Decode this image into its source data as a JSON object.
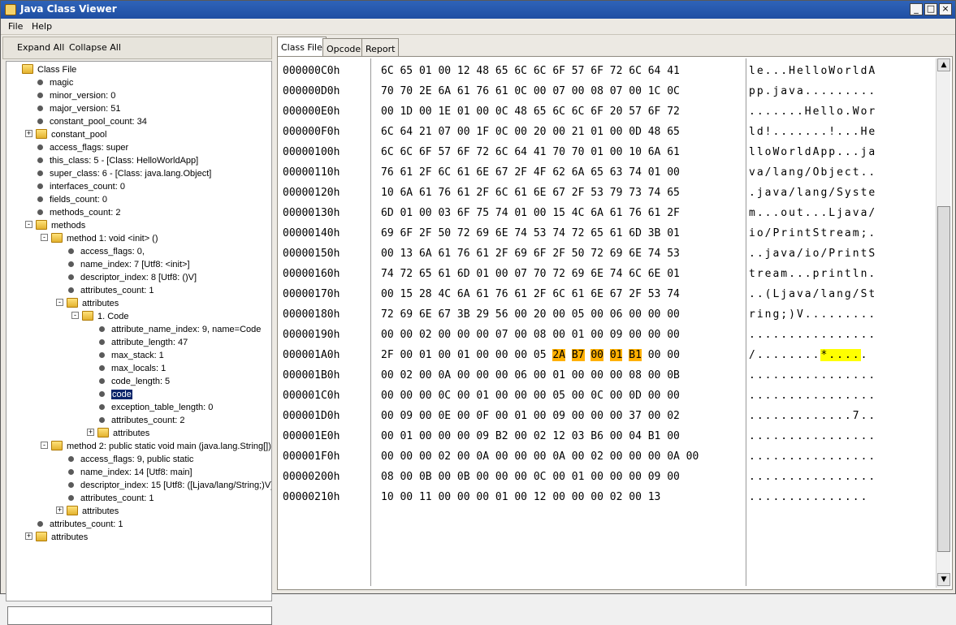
{
  "window": {
    "title": "Java Class Viewer",
    "minimize": "_",
    "maximize": "□",
    "close": "×"
  },
  "menu": [
    "File",
    "Help"
  ],
  "toolbar": {
    "expand_all": "Expand All",
    "collapse_all": "Collapse All"
  },
  "tree": [
    {
      "indent": 0,
      "kind": "folder",
      "toggle": "",
      "label": "Class File"
    },
    {
      "indent": 1,
      "kind": "leaf",
      "toggle": "",
      "label": "magic"
    },
    {
      "indent": 1,
      "kind": "leaf",
      "toggle": "",
      "label": "minor_version: 0"
    },
    {
      "indent": 1,
      "kind": "leaf",
      "toggle": "",
      "label": "major_version: 51"
    },
    {
      "indent": 1,
      "kind": "leaf",
      "toggle": "",
      "label": "constant_pool_count: 34"
    },
    {
      "indent": 1,
      "kind": "folder",
      "toggle": "+",
      "label": "constant_pool"
    },
    {
      "indent": 1,
      "kind": "leaf",
      "toggle": "",
      "label": "access_flags: super"
    },
    {
      "indent": 1,
      "kind": "leaf",
      "toggle": "",
      "label": "this_class: 5 - [Class: HelloWorldApp]"
    },
    {
      "indent": 1,
      "kind": "leaf",
      "toggle": "",
      "label": "super_class: 6 - [Class: java.lang.Object]"
    },
    {
      "indent": 1,
      "kind": "leaf",
      "toggle": "",
      "label": "interfaces_count: 0"
    },
    {
      "indent": 1,
      "kind": "leaf",
      "toggle": "",
      "label": "fields_count: 0"
    },
    {
      "indent": 1,
      "kind": "leaf",
      "toggle": "",
      "label": "methods_count: 2"
    },
    {
      "indent": 1,
      "kind": "folder",
      "toggle": "-",
      "label": "methods"
    },
    {
      "indent": 2,
      "kind": "folder",
      "toggle": "-",
      "label": "method 1:  void <init> ()"
    },
    {
      "indent": 3,
      "kind": "leaf",
      "toggle": "",
      "label": "access_flags: 0,"
    },
    {
      "indent": 3,
      "kind": "leaf",
      "toggle": "",
      "label": "name_index: 7 [Utf8: <init>]"
    },
    {
      "indent": 3,
      "kind": "leaf",
      "toggle": "",
      "label": "descriptor_index: 8 [Utf8: ()V]"
    },
    {
      "indent": 3,
      "kind": "leaf",
      "toggle": "",
      "label": "attributes_count: 1"
    },
    {
      "indent": 3,
      "kind": "folder",
      "toggle": "-",
      "label": "attributes"
    },
    {
      "indent": 4,
      "kind": "folder",
      "toggle": "-",
      "label": "1. Code"
    },
    {
      "indent": 5,
      "kind": "leaf",
      "toggle": "",
      "label": "attribute_name_index: 9, name=Code"
    },
    {
      "indent": 5,
      "kind": "leaf",
      "toggle": "",
      "label": "attribute_length: 47"
    },
    {
      "indent": 5,
      "kind": "leaf",
      "toggle": "",
      "label": "max_stack: 1"
    },
    {
      "indent": 5,
      "kind": "leaf",
      "toggle": "",
      "label": "max_locals: 1"
    },
    {
      "indent": 5,
      "kind": "leaf",
      "toggle": "",
      "label": "code_length: 5"
    },
    {
      "indent": 5,
      "kind": "leaf",
      "toggle": "",
      "label": "code",
      "selected": true
    },
    {
      "indent": 5,
      "kind": "leaf",
      "toggle": "",
      "label": "exception_table_length: 0"
    },
    {
      "indent": 5,
      "kind": "leaf",
      "toggle": "",
      "label": "attributes_count: 2"
    },
    {
      "indent": 5,
      "kind": "folder",
      "toggle": "+",
      "label": "attributes"
    },
    {
      "indent": 2,
      "kind": "folder",
      "toggle": "-",
      "label": "method 2: public static void main (java.lang.String[])"
    },
    {
      "indent": 3,
      "kind": "leaf",
      "toggle": "",
      "label": "access_flags: 9, public static"
    },
    {
      "indent": 3,
      "kind": "leaf",
      "toggle": "",
      "label": "name_index: 14 [Utf8: main]"
    },
    {
      "indent": 3,
      "kind": "leaf",
      "toggle": "",
      "label": "descriptor_index: 15 [Utf8: ([Ljava/lang/String;)V]"
    },
    {
      "indent": 3,
      "kind": "leaf",
      "toggle": "",
      "label": "attributes_count: 1"
    },
    {
      "indent": 3,
      "kind": "folder",
      "toggle": "+",
      "label": "attributes"
    },
    {
      "indent": 1,
      "kind": "leaf",
      "toggle": "",
      "label": "attributes_count: 1"
    },
    {
      "indent": 1,
      "kind": "folder",
      "toggle": "+",
      "label": "attributes"
    }
  ],
  "tabs": [
    "Class File",
    "Opcode",
    "Report"
  ],
  "hex_rows": [
    {
      "addr": "000000C0h",
      "hex": "6C 65 01 00 12 48 65 6C 6C 6F 57 6F 72 6C 64 41",
      "ascii": "le...HelloWorldA"
    },
    {
      "addr": "000000D0h",
      "hex": "70 70 2E 6A 61 76 61 0C 00 07 00 08 07 00 1C 0C",
      "ascii": "pp.java........."
    },
    {
      "addr": "000000E0h",
      "hex": "00 1D 00 1E 01 00 0C 48 65 6C 6C 6F 20 57 6F 72",
      "ascii": ".......Hello.Wor"
    },
    {
      "addr": "000000F0h",
      "hex": "6C 64 21 07 00 1F 0C 00 20 00 21 01 00 0D 48 65",
      "ascii": "ld!.......!...He"
    },
    {
      "addr": "00000100h",
      "hex": "6C 6C 6F 57 6F 72 6C 64 41 70 70 01 00 10 6A 61",
      "ascii": "lloWorldApp...ja"
    },
    {
      "addr": "00000110h",
      "hex": "76 61 2F 6C 61 6E 67 2F 4F 62 6A 65 63 74 01 00",
      "ascii": "va/lang/Object.."
    },
    {
      "addr": "00000120h",
      "hex": "10 6A 61 76 61 2F 6C 61 6E 67 2F 53 79 73 74 65",
      "ascii": ".java/lang/Syste"
    },
    {
      "addr": "00000130h",
      "hex": "6D 01 00 03 6F 75 74 01 00 15 4C 6A 61 76 61 2F",
      "ascii": "m...out...Ljava/"
    },
    {
      "addr": "00000140h",
      "hex": "69 6F 2F 50 72 69 6E 74 53 74 72 65 61 6D 3B 01",
      "ascii": "io/PrintStream;."
    },
    {
      "addr": "00000150h",
      "hex": "00 13 6A 61 76 61 2F 69 6F 2F 50 72 69 6E 74 53",
      "ascii": "..java/io/PrintS"
    },
    {
      "addr": "00000160h",
      "hex": "74 72 65 61 6D 01 00 07 70 72 69 6E 74 6C 6E 01",
      "ascii": "tream...println."
    },
    {
      "addr": "00000170h",
      "hex": "00 15 28 4C 6A 61 76 61 2F 6C 61 6E 67 2F 53 74",
      "ascii": "..(Ljava/lang/St"
    },
    {
      "addr": "00000180h",
      "hex": "72 69 6E 67 3B 29 56 00 20 00 05 00 06 00 00 00",
      "ascii": "ring;)V........."
    },
    {
      "addr": "00000190h",
      "hex": "00 00 02 00 00 00 07 00 08 00 01 00 09 00 00 00",
      "ascii": "................"
    },
    {
      "addr": "000001A0h",
      "hex": "2F 00 01 00 01 00 00 00 05 2A B7 00 01 B1 00 00",
      "ascii": "/........*.....",
      "hl_start": 9,
      "hl_len": 5
    },
    {
      "addr": "000001B0h",
      "hex": "00 02 00 0A 00 00 00 06 00 01 00 00 00 08 00 0B",
      "ascii": "................"
    },
    {
      "addr": "000001C0h",
      "hex": "00 00 00 0C 00 01 00 00 00 05 00 0C 00 0D 00 00",
      "ascii": "................"
    },
    {
      "addr": "000001D0h",
      "hex": "00 09 00 0E 00 0F 00 01 00 09 00 00 00 37 00 02",
      "ascii": ".............7.."
    },
    {
      "addr": "000001E0h",
      "hex": "00 01 00 00 00 09 B2 00 02 12 03 B6 00 04 B1 00",
      "ascii": "................"
    },
    {
      "addr": "000001F0h",
      "hex": "00 00 00 02 00 0A 00 00 00 0A 00 02 00 00 00 0A 00",
      "ascii": "................"
    },
    {
      "addr": "00000200h",
      "hex": "08 00 0B 00 0B 00 00 00 0C 00 01 00 00 00 09 00",
      "ascii": "................"
    },
    {
      "addr": "00000210h",
      "hex": "10 00 11 00 00 00 01 00 12 00 00 00 02 00 13",
      "ascii": "..............."
    }
  ]
}
